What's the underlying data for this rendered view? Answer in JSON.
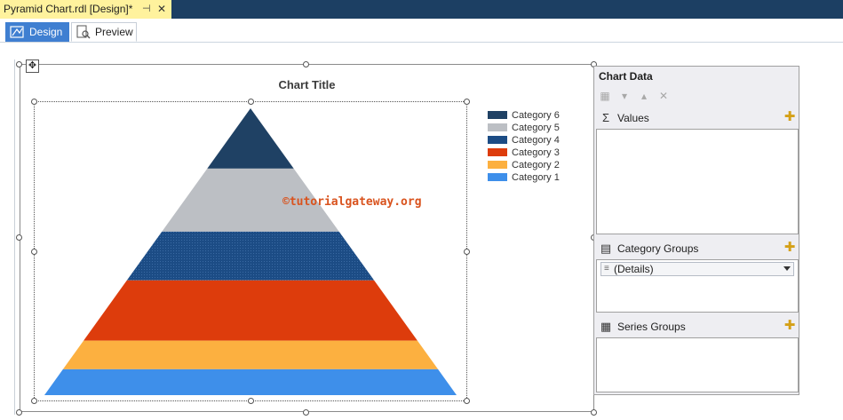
{
  "document_tab": {
    "title": "Pyramid Chart.rdl [Design]*",
    "pin_icon": "pin-icon",
    "close_icon": "close-icon"
  },
  "mode_tabs": [
    {
      "label": "Design",
      "icon": "design-icon",
      "active": true
    },
    {
      "label": "Preview",
      "icon": "preview-icon",
      "active": false
    }
  ],
  "chart": {
    "title": "Chart Title",
    "watermark": "©tutorialgateway.org"
  },
  "chart_data": {
    "type": "pyramid",
    "title": "Chart Title",
    "legend_position": "top-right",
    "series": [
      {
        "name": "Category 6",
        "color": "#1f4164",
        "value": 1
      },
      {
        "name": "Category 5",
        "color": "#bcbfc4",
        "value": 1
      },
      {
        "name": "Category 4",
        "color": "#1c4c85",
        "value": 1
      },
      {
        "name": "Category 3",
        "color": "#dd3c0c",
        "value": 1
      },
      {
        "name": "Category 2",
        "color": "#fcb040",
        "value": 1
      },
      {
        "name": "Category 1",
        "color": "#3e8fea",
        "value": 1
      }
    ]
  },
  "panel": {
    "title": "Chart Data",
    "toolbar_icons": [
      "properties-icon",
      "move-down-icon",
      "move-up-icon",
      "delete-icon"
    ],
    "values": {
      "label": "Values",
      "icon": "sigma-icon"
    },
    "category_groups": {
      "label": "Category Groups",
      "icon": "category-groups-icon",
      "selected": "(Details)"
    },
    "series_groups": {
      "label": "Series Groups",
      "icon": "series-groups-icon"
    }
  }
}
